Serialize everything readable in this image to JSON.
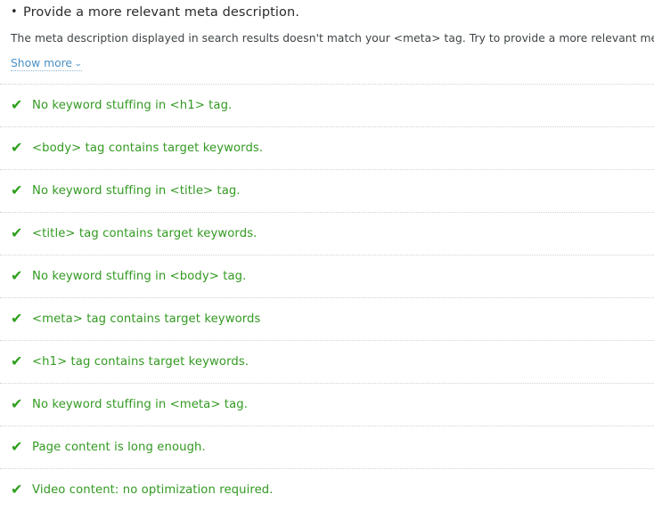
{
  "colors": {
    "check_green": "#2f9e1e",
    "label_green": "#339a22",
    "link_blue": "#4a90c4",
    "title_dark": "#2b2b2b",
    "desc_gray": "#3e4447",
    "separator": "#d2d2d2",
    "background": "#ffffff"
  },
  "issue": {
    "bullet": "•",
    "title": "Provide a more relevant meta description.",
    "description": "The meta description displayed in search results doesn't match your <meta> tag. Try to provide a more relevant meta description.",
    "show_more_label": "Show more",
    "show_more_chevron": "⌄"
  },
  "check_icon": "✔",
  "checks": [
    {
      "label": "No keyword stuffing in <h1> tag."
    },
    {
      "label": "<body> tag contains target keywords."
    },
    {
      "label": "No keyword stuffing in <title> tag."
    },
    {
      "label": "<title> tag contains target keywords."
    },
    {
      "label": "No keyword stuffing in <body> tag."
    },
    {
      "label": "<meta> tag contains target keywords"
    },
    {
      "label": "<h1> tag contains target keywords."
    },
    {
      "label": "No keyword stuffing in <meta> tag."
    },
    {
      "label": "Page content is long enough."
    },
    {
      "label": "Video content: no optimization required."
    }
  ]
}
